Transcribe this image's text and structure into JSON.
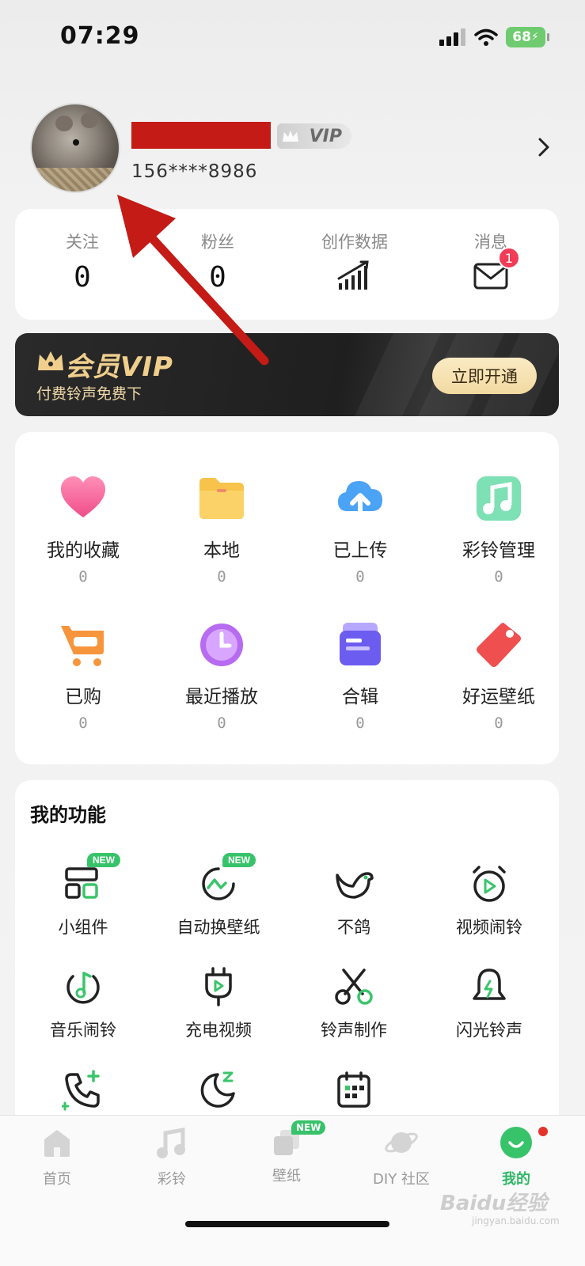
{
  "status_bar": {
    "time": "07:29",
    "battery": "68"
  },
  "profile": {
    "vip_label": "VIP",
    "phone": "156****8986"
  },
  "stats": [
    {
      "label": "关注",
      "value": "0"
    },
    {
      "label": "粉丝",
      "value": "0"
    },
    {
      "label": "创作数据",
      "icon": "chart-icon"
    },
    {
      "label": "消息",
      "icon": "mail-icon",
      "badge": "1"
    }
  ],
  "vip_banner": {
    "title": "会员VIP",
    "subtitle": "付费铃声免费下",
    "button": "立即开通"
  },
  "collection": [
    {
      "label": "我的收藏",
      "count": "0",
      "icon": "heart-icon"
    },
    {
      "label": "本地",
      "count": "0",
      "icon": "folder-icon"
    },
    {
      "label": "已上传",
      "count": "0",
      "icon": "cloud-upload-icon"
    },
    {
      "label": "彩铃管理",
      "count": "0",
      "icon": "music-note-icon"
    },
    {
      "label": "已购",
      "count": "0",
      "icon": "cart-icon"
    },
    {
      "label": "最近播放",
      "count": "0",
      "icon": "clock-icon"
    },
    {
      "label": "合辑",
      "count": "0",
      "icon": "album-icon"
    },
    {
      "label": "好运壁纸",
      "count": "0",
      "icon": "lucky-tag-icon"
    }
  ],
  "functions": {
    "title": "我的功能",
    "new_tag": "NEW",
    "items": [
      {
        "label": "小组件",
        "icon": "widget-icon",
        "new": true
      },
      {
        "label": "自动换壁纸",
        "icon": "auto-wallpaper-icon",
        "new": true
      },
      {
        "label": "不鸽",
        "icon": "bird-icon"
      },
      {
        "label": "视频闹铃",
        "icon": "video-alarm-icon"
      },
      {
        "label": "音乐闹铃",
        "icon": "music-alarm-icon"
      },
      {
        "label": "充电视频",
        "icon": "charge-video-icon"
      },
      {
        "label": "铃声制作",
        "icon": "scissors-icon"
      },
      {
        "label": "闪光铃声",
        "icon": "flash-bell-icon"
      },
      {
        "label": "",
        "icon": "phone-add-icon"
      },
      {
        "label": "",
        "icon": "moon-icon"
      },
      {
        "label": "",
        "icon": "calendar-icon"
      }
    ]
  },
  "bottom_nav": {
    "new_tag": "NEW",
    "items": [
      {
        "label": "首页",
        "icon": "home-icon"
      },
      {
        "label": "彩铃",
        "icon": "music-note-icon"
      },
      {
        "label": "壁纸",
        "icon": "wallpaper-icon"
      },
      {
        "label": "DIY 社区",
        "icon": "planet-icon"
      },
      {
        "label": "我的",
        "icon": "profile-icon",
        "active": true
      }
    ]
  },
  "watermark": {
    "text": "Baidu经验",
    "sub": "jingyan.baidu.com"
  },
  "colors": {
    "accent": "#2fb866",
    "vip_gold": "#f0cf8d",
    "annotation_arrow": "#c41b16",
    "badge_red": "#f23b56"
  }
}
